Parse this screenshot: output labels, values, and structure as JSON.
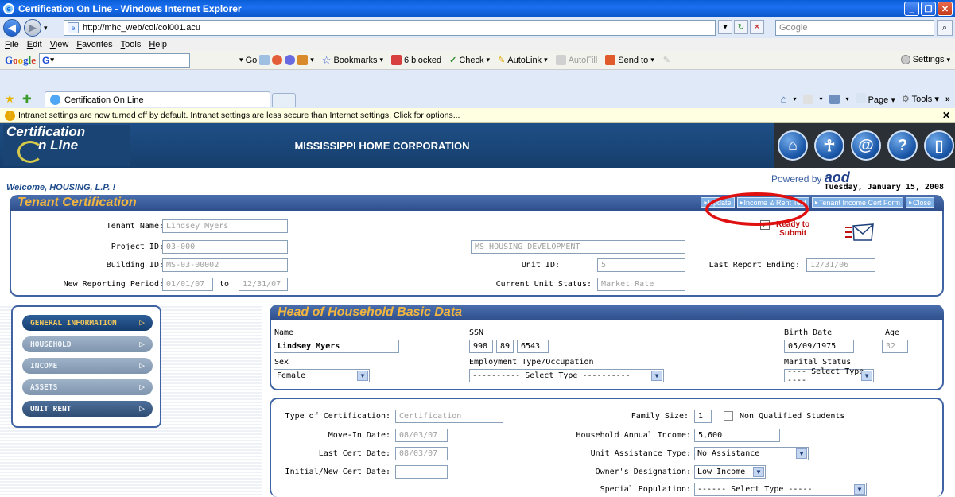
{
  "window": {
    "title": "Certification On Line - Windows Internet Explorer"
  },
  "address": {
    "url": "http://mhc_web/col/col001.acu",
    "search_placeholder": "Google"
  },
  "menu": [
    "File",
    "Edit",
    "View",
    "Favorites",
    "Tools",
    "Help"
  ],
  "google_toolbar": {
    "search_value": "G",
    "go": "Go",
    "bookmarks": "Bookmarks",
    "blocked": "6 blocked",
    "check": "Check",
    "autolink": "AutoLink",
    "autofill": "AutoFill",
    "sendto": "Send to",
    "settings": "Settings"
  },
  "tabs": {
    "active": "Certification On Line"
  },
  "commandbar": {
    "page": "Page",
    "tools": "Tools"
  },
  "infobar": {
    "message": "Intranet settings are now turned off by default. Intranet settings are less secure than Internet settings. Click for options..."
  },
  "app": {
    "logo_line1": "Certification",
    "logo_line2": "n Line",
    "title": "MISSISSIPPI HOME CORPORATION",
    "powered_by": "Powered by",
    "powered_brand": "aod",
    "welcome": "Welcome, HOUSING, L.P. !",
    "date": "Tuesday, January 15, 2008",
    "header_icons": [
      "home-icon",
      "accessibility-icon",
      "email-icon",
      "help-icon",
      "exit-icon"
    ]
  },
  "tenant": {
    "section_title": "Tenant Certification",
    "buttons": [
      "Update",
      "Income & Rent Test",
      "Tenant Income Cert Form",
      "Close"
    ],
    "tenant_name_label": "Tenant Name:",
    "tenant_name": "Lindsey Myers",
    "project_id_label": "Project ID:",
    "project_id": "03-000",
    "project_name": "MS HOUSING DEVELOPMENT",
    "building_id_label": "Building ID:",
    "building_id": "MS-03-00002",
    "unit_id_label": "Unit ID:",
    "unit_id": "5",
    "last_report_label": "Last Report Ending:",
    "last_report": "12/31/06",
    "period_label": "New Reporting Period:",
    "period_from": "01/01/07",
    "period_to_label": "to",
    "period_to": "12/31/07",
    "unit_status_label": "Current Unit Status:",
    "unit_status": "Market Rate",
    "ready_label_1": "Ready to",
    "ready_label_2": "Submit",
    "ready_checked": true
  },
  "nav": {
    "items": [
      {
        "label": "GENERAL INFORMATION",
        "state": "active"
      },
      {
        "label": "HOUSEHOLD",
        "state": "dim"
      },
      {
        "label": "INCOME",
        "state": "dim"
      },
      {
        "label": "ASSETS",
        "state": "dim"
      },
      {
        "label": "UNIT RENT",
        "state": "normal"
      }
    ]
  },
  "head": {
    "section_title": "Head of Household Basic Data",
    "name_label": "Name",
    "name": "Lindsey Myers",
    "ssn_label": "SSN",
    "ssn1": "998",
    "ssn2": "89",
    "ssn3": "6543",
    "birth_label": "Birth Date",
    "birth": "05/09/1975",
    "age_label": "Age",
    "age": "32",
    "sex_label": "Sex",
    "sex": "Female",
    "employment_label": "Employment Type/Occupation",
    "employment": "---------- Select Type ----------",
    "marital_label": "Marital Status",
    "marital": "---- Select Type ----"
  },
  "cert": {
    "type_label": "Type of Certification:",
    "type": "Certification",
    "movein_label": "Move-In Date:",
    "movein": "08/03/07",
    "lastcert_label": "Last Cert Date:",
    "lastcert": "08/03/07",
    "initial_label": "Initial/New Cert Date:",
    "initial": "",
    "family_label": "Family Size:",
    "family": "1",
    "nonqual_label": "Non Qualified Students",
    "income_label": "Household Annual Income:",
    "income": "5,600",
    "assist_label": "Unit Assistance Type:",
    "assist": "No Assistance",
    "owner_label": "Owner's Designation:",
    "owner": "Low Income",
    "special_label": "Special Population:",
    "special": "------ Select Type -----"
  }
}
